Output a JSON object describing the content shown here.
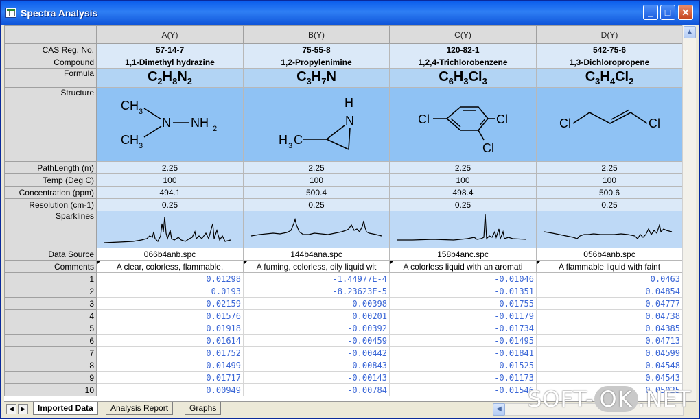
{
  "window": {
    "title": "Spectra Analysis",
    "minimize_label": "_",
    "maximize_label": "□",
    "close_label": "✕"
  },
  "columns": [
    "A(Y)",
    "B(Y)",
    "C(Y)",
    "D(Y)"
  ],
  "row_labels": {
    "cas": "CAS Reg. No.",
    "compound": "Compound",
    "formula": "Formula",
    "structure": "Structure",
    "pathlength": "PathLength (m)",
    "temp": "Temp (Deg C)",
    "concentration": "Concentration (ppm)",
    "resolution": "Resolution (cm-1)",
    "sparklines": "Sparklines",
    "datasource": "Data Source",
    "comments": "Comments"
  },
  "cas": [
    "57-14-7",
    "75-55-8",
    "120-82-1",
    "542-75-6"
  ],
  "compound": [
    "1,1-Dimethyl hydrazine",
    "1,2-Propylenimine",
    "1,2,4-Trichlorobenzene",
    "1,3-Dichloropropene"
  ],
  "formula": [
    {
      "p": [
        "C",
        "2",
        "H",
        "8",
        "N",
        "2"
      ]
    },
    {
      "p": [
        "C",
        "3",
        "H",
        "7",
        "N",
        ""
      ]
    },
    {
      "p": [
        "C",
        "6",
        "H",
        "3",
        "Cl",
        "3"
      ]
    },
    {
      "p": [
        "C",
        "3",
        "H",
        "4",
        "Cl",
        "2"
      ]
    }
  ],
  "structure_labels": {
    "a": {
      "ch3a": "CH",
      "s3a": "3",
      "ch3b": "CH",
      "s3b": "3",
      "n": "N",
      "nh2": "NH",
      "s2": "2"
    },
    "b": {
      "h": "H",
      "n": "N",
      "h3c": "H",
      "s3": "3",
      "c": "C"
    },
    "c": {
      "cl1": "Cl",
      "cl2": "Cl",
      "cl3": "Cl"
    },
    "d": {
      "cl1": "Cl",
      "cl2": "Cl"
    }
  },
  "pathlength": [
    "2.25",
    "2.25",
    "2.25",
    "2.25"
  ],
  "temp": [
    "100",
    "100",
    "100",
    "100"
  ],
  "concentration": [
    "494.1",
    "500.4",
    "498.4",
    "500.6"
  ],
  "resolution": [
    "0.25",
    "0.25",
    "0.25",
    "0.25"
  ],
  "datasource": [
    "066b4anb.spc",
    "144b4ana.spc",
    "158b4anc.spc",
    "056b4anb.spc"
  ],
  "comments": [
    "A clear, colorless, flammable,",
    "A fuming, colorless, oily liquid wit",
    "A colorless liquid with an aromati",
    "A flammable liquid with faint"
  ],
  "rows": [
    {
      "n": "1",
      "v": [
        "0.01298",
        "-1.44977E-4",
        "-0.01046",
        "0.0463"
      ]
    },
    {
      "n": "2",
      "v": [
        "0.0193",
        "-8.23623E-5",
        "-0.01351",
        "0.04854"
      ]
    },
    {
      "n": "3",
      "v": [
        "0.02159",
        "-0.00398",
        "-0.01755",
        "0.04777"
      ]
    },
    {
      "n": "4",
      "v": [
        "0.01576",
        "0.00201",
        "-0.01179",
        "0.04738"
      ]
    },
    {
      "n": "5",
      "v": [
        "0.01918",
        "-0.00392",
        "-0.01734",
        "0.04385"
      ]
    },
    {
      "n": "6",
      "v": [
        "0.01614",
        "-0.00459",
        "-0.01495",
        "0.04713"
      ]
    },
    {
      "n": "7",
      "v": [
        "0.01752",
        "-0.00442",
        "-0.01841",
        "0.04599"
      ]
    },
    {
      "n": "8",
      "v": [
        "0.01499",
        "-0.00843",
        "-0.01525",
        "0.04548"
      ]
    },
    {
      "n": "9",
      "v": [
        "0.01717",
        "-0.00143",
        "-0.01173",
        "0.04543"
      ]
    },
    {
      "n": "10",
      "v": [
        "0.00949",
        "-0.00784",
        "-0.01546",
        "0.05025"
      ]
    }
  ],
  "tabs": [
    "Imported Data",
    "Analysis Report",
    "Graphs"
  ],
  "watermark": {
    "a": "SOFT-",
    "b": "OK",
    ".c": "",
    "c": ".NET"
  },
  "colors": {
    "title_bar": "#0a5cec",
    "formula_bg": "#b2d4f4",
    "structure_bg": "#8fc2f4",
    "value_text": "#3a66d6"
  }
}
